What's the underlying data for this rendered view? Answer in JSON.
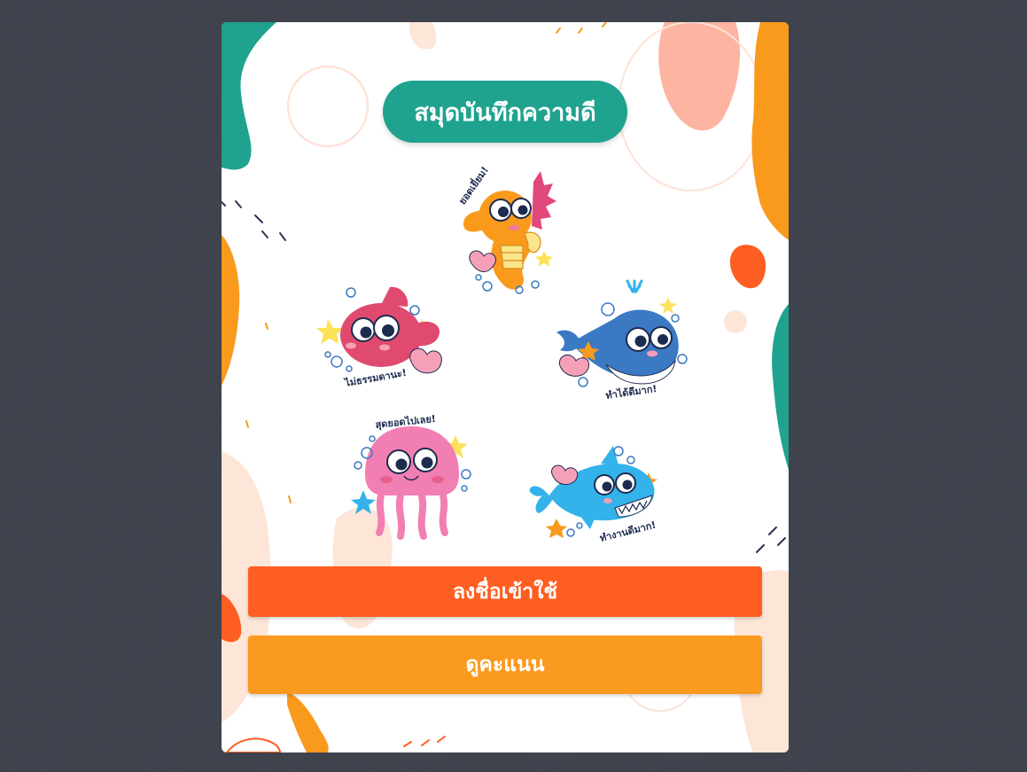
{
  "app": {
    "title": "สมุดบันทึกความดี"
  },
  "stickers": [
    {
      "id": "seahorse",
      "caption": "ยอดเยี่ยม!",
      "color": "#f99a1d",
      "icon": "seahorse-icon"
    },
    {
      "id": "fish",
      "caption": "ไม่ธรรมดานะ!",
      "color": "#e04a6e",
      "icon": "fish-icon"
    },
    {
      "id": "whale",
      "caption": "ทำได้ดีมาก!",
      "color": "#3b79c3",
      "icon": "whale-icon"
    },
    {
      "id": "jellyfish",
      "caption": "สุดยอดไปเลย!",
      "color": "#f27fb3",
      "icon": "jellyfish-icon"
    },
    {
      "id": "shark",
      "caption": "ทำงานดีมาก!",
      "color": "#33b3ea",
      "icon": "shark-icon"
    }
  ],
  "buttons": {
    "login": {
      "label": "ลงชื่อเข้าใช้",
      "color": "#ff5e22"
    },
    "score": {
      "label": "ดูคะแนน",
      "color": "#fa9a1f"
    }
  },
  "colors": {
    "teal": "#1fa38f",
    "orange": "#f99a1d",
    "peach": "#fdb4a0",
    "page_background": "#3f434d"
  }
}
